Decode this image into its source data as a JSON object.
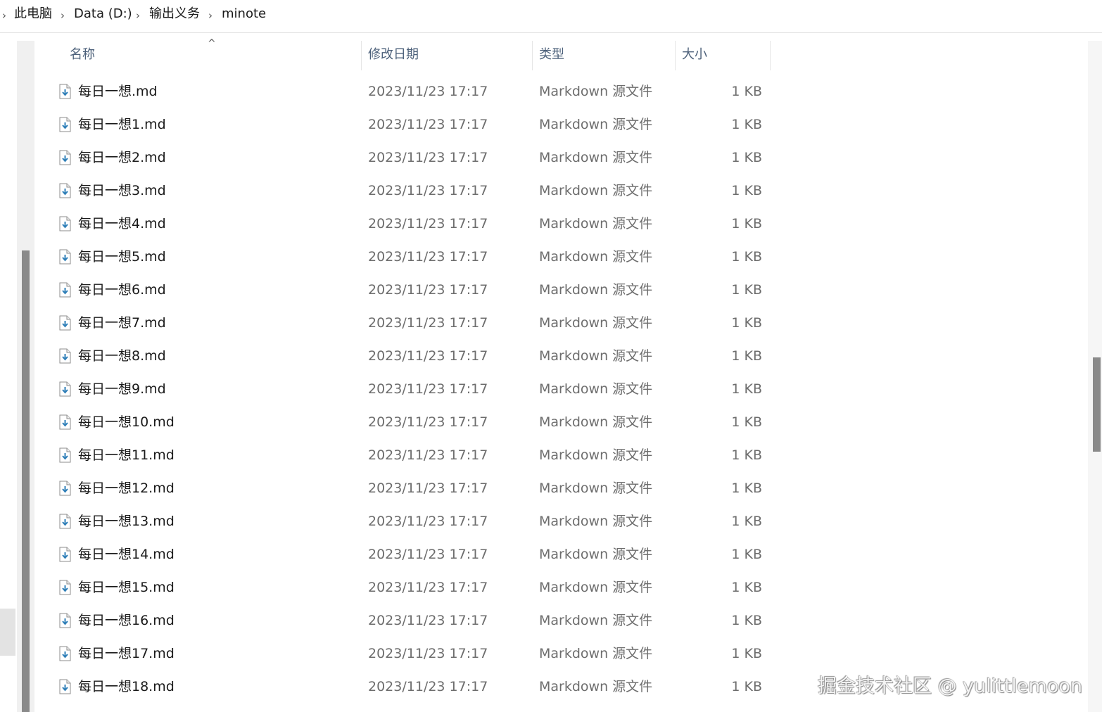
{
  "breadcrumb": {
    "items": [
      "此电脑",
      "Data (D:)",
      "输出义务",
      "minote"
    ],
    "separator": "›"
  },
  "columns": {
    "name": "名称",
    "date": "修改日期",
    "type": "类型",
    "size": "大小"
  },
  "files": [
    {
      "name": "每日一想.md",
      "date": "2023/11/23 17:17",
      "type": "Markdown 源文件",
      "size": "1 KB"
    },
    {
      "name": "每日一想1.md",
      "date": "2023/11/23 17:17",
      "type": "Markdown 源文件",
      "size": "1 KB"
    },
    {
      "name": "每日一想2.md",
      "date": "2023/11/23 17:17",
      "type": "Markdown 源文件",
      "size": "1 KB"
    },
    {
      "name": "每日一想3.md",
      "date": "2023/11/23 17:17",
      "type": "Markdown 源文件",
      "size": "1 KB"
    },
    {
      "name": "每日一想4.md",
      "date": "2023/11/23 17:17",
      "type": "Markdown 源文件",
      "size": "1 KB"
    },
    {
      "name": "每日一想5.md",
      "date": "2023/11/23 17:17",
      "type": "Markdown 源文件",
      "size": "1 KB"
    },
    {
      "name": "每日一想6.md",
      "date": "2023/11/23 17:17",
      "type": "Markdown 源文件",
      "size": "1 KB"
    },
    {
      "name": "每日一想7.md",
      "date": "2023/11/23 17:17",
      "type": "Markdown 源文件",
      "size": "1 KB"
    },
    {
      "name": "每日一想8.md",
      "date": "2023/11/23 17:17",
      "type": "Markdown 源文件",
      "size": "1 KB"
    },
    {
      "name": "每日一想9.md",
      "date": "2023/11/23 17:17",
      "type": "Markdown 源文件",
      "size": "1 KB"
    },
    {
      "name": "每日一想10.md",
      "date": "2023/11/23 17:17",
      "type": "Markdown 源文件",
      "size": "1 KB"
    },
    {
      "name": "每日一想11.md",
      "date": "2023/11/23 17:17",
      "type": "Markdown 源文件",
      "size": "1 KB"
    },
    {
      "name": "每日一想12.md",
      "date": "2023/11/23 17:17",
      "type": "Markdown 源文件",
      "size": "1 KB"
    },
    {
      "name": "每日一想13.md",
      "date": "2023/11/23 17:17",
      "type": "Markdown 源文件",
      "size": "1 KB"
    },
    {
      "name": "每日一想14.md",
      "date": "2023/11/23 17:17",
      "type": "Markdown 源文件",
      "size": "1 KB"
    },
    {
      "name": "每日一想15.md",
      "date": "2023/11/23 17:17",
      "type": "Markdown 源文件",
      "size": "1 KB"
    },
    {
      "name": "每日一想16.md",
      "date": "2023/11/23 17:17",
      "type": "Markdown 源文件",
      "size": "1 KB"
    },
    {
      "name": "每日一想17.md",
      "date": "2023/11/23 17:17",
      "type": "Markdown 源文件",
      "size": "1 KB"
    },
    {
      "name": "每日一想18.md",
      "date": "2023/11/23 17:17",
      "type": "Markdown 源文件",
      "size": "1 KB"
    }
  ],
  "icons": {
    "file": "markdown-file-icon",
    "sort": "sort-ascending-icon"
  },
  "watermark": "掘金技术社区 @ yulittlemoon",
  "colors": {
    "header_text": "#4c607a",
    "meta_text": "#6d6d6d",
    "icon_accent": "#2f7fb8"
  }
}
